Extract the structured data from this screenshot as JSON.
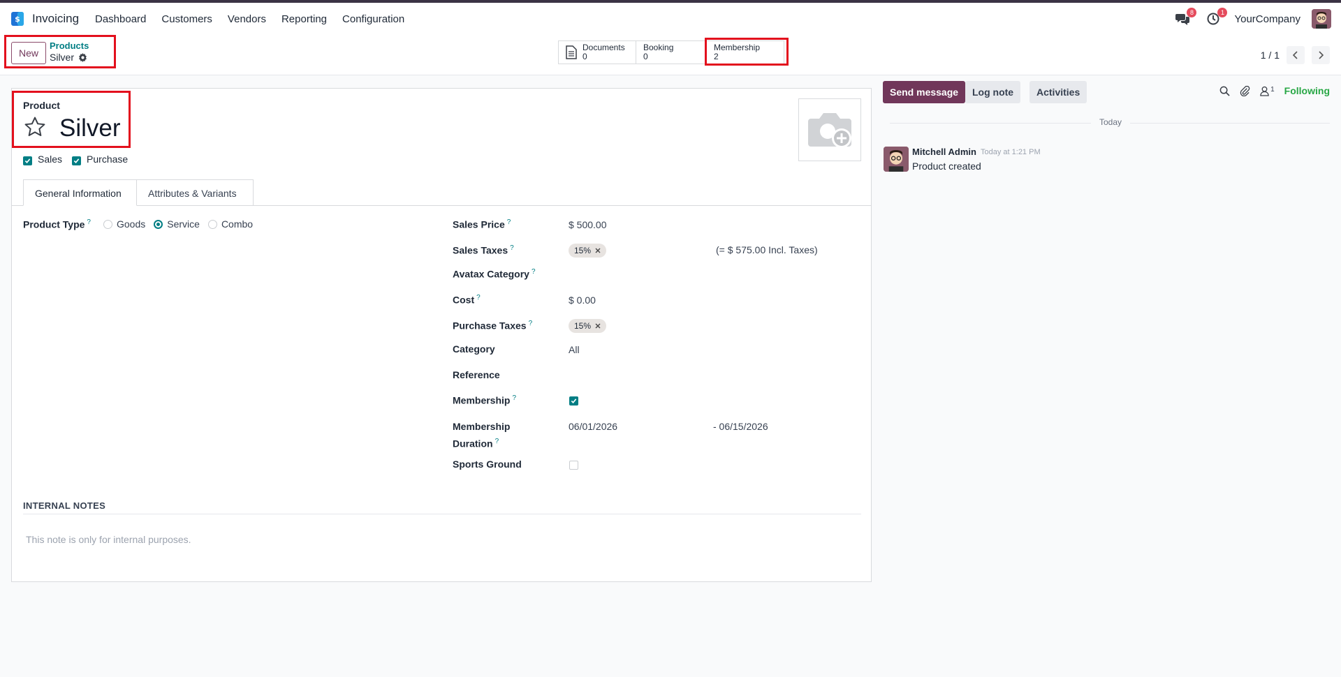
{
  "navbar": {
    "app_name": "Invoicing",
    "menu": [
      "Dashboard",
      "Customers",
      "Vendors",
      "Reporting",
      "Configuration"
    ],
    "messages_count": "8",
    "activities_count": "1",
    "company": "YourCompany"
  },
  "controlbar": {
    "new_label": "New",
    "breadcrumb_parent": "Products",
    "breadcrumb_current": "Silver",
    "smart_buttons": [
      {
        "label": "Documents",
        "value": "0"
      },
      {
        "label": "Booking",
        "value": "0"
      },
      {
        "label": "Membership",
        "value": "2"
      }
    ],
    "pager": "1 / 1"
  },
  "form": {
    "product_label": "Product",
    "product_name": "Silver",
    "sales_label": "Sales",
    "purchase_label": "Purchase",
    "tabs": [
      "General Information",
      "Attributes & Variants"
    ],
    "product_type_label": "Product Type",
    "product_type_options": [
      "Goods",
      "Service",
      "Combo"
    ],
    "product_type_selected": "Service",
    "fields": {
      "sales_price_label": "Sales Price",
      "sales_price_value": "$ 500.00",
      "sales_taxes_label": "Sales Taxes",
      "sales_taxes_tag": "15%",
      "sales_taxes_incl": "(= $ 575.00 Incl. Taxes)",
      "avatax_label": "Avatax Category",
      "cost_label": "Cost",
      "cost_value": "$ 0.00",
      "purchase_taxes_label": "Purchase Taxes",
      "purchase_taxes_tag": "15%",
      "category_label": "Category",
      "category_value": "All",
      "reference_label": "Reference",
      "membership_label": "Membership",
      "membership_duration_label_1": "Membership",
      "membership_duration_label_2": "Duration",
      "membership_start": "06/01/2026",
      "membership_end": "- 06/15/2026",
      "sports_ground_label": "Sports Ground"
    },
    "notes_title": "INTERNAL NOTES",
    "notes_placeholder": "This note is only for internal purposes."
  },
  "chatter": {
    "send_message": "Send message",
    "log_note": "Log note",
    "activities": "Activities",
    "followers_count": "1",
    "following": "Following",
    "today": "Today",
    "message": {
      "author": "Mitchell Admin",
      "time": "Today at 1:21 PM",
      "body": "Product created"
    }
  },
  "colors": {
    "brand": "#71375a",
    "teal": "#017e84",
    "highlight": "#e3101d",
    "success": "#28a745"
  }
}
